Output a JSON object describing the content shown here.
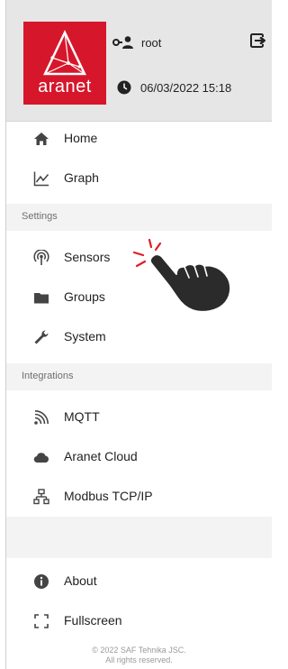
{
  "header": {
    "logo_text": "aranet",
    "user_name": "root",
    "datetime": "06/03/2022 15:18"
  },
  "menu": {
    "home": "Home",
    "graph": "Graph",
    "settings_section": "Settings",
    "sensors": "Sensors",
    "groups": "Groups",
    "system": "System",
    "integrations_section": "Integrations",
    "mqtt": "MQTT",
    "aranet_cloud": "Aranet Cloud",
    "modbus": "Modbus TCP/IP",
    "about": "About",
    "fullscreen": "Fullscreen"
  },
  "footer": {
    "line1": "© 2022 SAF Tehnika JSC.",
    "line2": "All rights reserved."
  },
  "colors": {
    "brand_red": "#d6172b",
    "header_bg": "#e6e6e6",
    "section_bg": "#f3f3f3"
  }
}
